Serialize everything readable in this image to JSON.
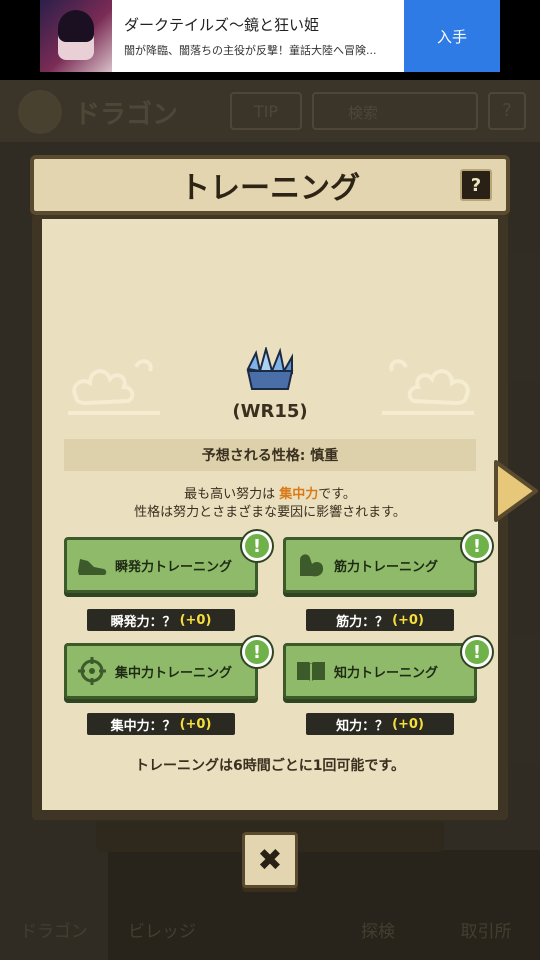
{
  "ad": {
    "title": "ダークテイルズ〜鏡と狂い姫",
    "subtitle": "闇が降臨、闇落ちの主役が反撃！童話大陸へ冒険...",
    "button": "入手"
  },
  "background": {
    "title": "ドラゴン",
    "tip": "TIP",
    "search_placeholder": "検索",
    "help": "?",
    "nav": [
      "ドラゴン",
      "ビレッジ",
      "探検",
      "取引所"
    ]
  },
  "modal": {
    "title": "トレーニング",
    "help": "?",
    "wr_label": "(WR15)",
    "personality": "予想される性格: 慎重",
    "desc_line1_pre": "最も高い努力は ",
    "desc_line1_highlight": "集中力",
    "desc_line1_post": "です。",
    "desc_line2": "性格は努力とさまざまな要因に影響されます。",
    "trainings": [
      {
        "label": "瞬発力トレーニング",
        "icon": "shoe-icon",
        "badge": "!",
        "stat_label": "瞬発力：？",
        "stat_value": "(+0)"
      },
      {
        "label": "筋力トレーニング",
        "icon": "muscle-arm-icon",
        "badge": "!",
        "stat_label": "筋力：？",
        "stat_value": "(+0)"
      },
      {
        "label": "集中力トレーニング",
        "icon": "crosshair-icon",
        "badge": "!",
        "stat_label": "集中力：？",
        "stat_value": "(+0)"
      },
      {
        "label": "知力トレーニング",
        "icon": "book-icon",
        "badge": "!",
        "stat_label": "知力：？",
        "stat_value": "(+0)"
      }
    ],
    "footer_note": "トレーニングは6時間ごとに1回可能です。",
    "close": "✖"
  },
  "colors": {
    "paper": "#eadfbf",
    "button_green": "#8fba6a",
    "highlight": "#d97a18",
    "stat_value": "#f6df3c"
  }
}
